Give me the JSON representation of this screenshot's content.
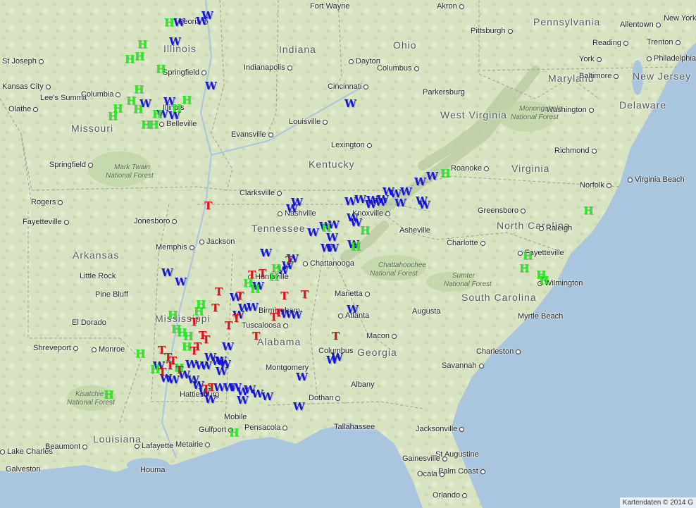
{
  "attribution": "Kartendaten © 2014 G",
  "colors": {
    "water": "#a9c6de",
    "land": "#d9e4c4",
    "forest": "#c4d7ab",
    "W": "#1414e0",
    "H": "#22ee22",
    "T": "#e01414"
  },
  "states": [
    "Illinois",
    "Indiana",
    "Ohio",
    "Pennsylvania",
    "Missouri",
    "Kentucky",
    "West Virginia",
    "Virginia",
    "Maryland",
    "New Jersey",
    "Delaware",
    "Tennessee",
    "North Carolina",
    "Arkansas",
    "South Carolina",
    "Mississippi",
    "Alabama",
    "Georgia",
    "Louisiana"
  ],
  "cities": [
    "Peoria",
    "Fort Wayne",
    "Akron",
    "New York",
    "Pittsburgh",
    "Allentown",
    "St Joseph",
    "Illinois",
    "Indianapolis",
    "Dayton",
    "Columbus",
    "Reading",
    "Trenton",
    "York",
    "Philadelphia",
    "Kansas City",
    "Lee's Summit",
    "Olathe",
    "Columbia",
    "Springfield",
    "Cincinnati",
    "Parkersburg",
    "Baltimore",
    "Belleville",
    "Louisville",
    "Evansville",
    "Washington",
    "Lexington",
    "Richmond",
    "Springfield",
    "Roanoke",
    "Norfolk",
    "Virginia Beach",
    "Clarksville",
    "Rogers",
    "Nashville",
    "Knoxville",
    "Greensboro",
    "Fayetteville",
    "Jonesboro",
    "Jackson",
    "Asheville",
    "Raleigh",
    "Memphis",
    "Charlotte",
    "Fayetteville",
    "Chattanooga",
    "Huntsville",
    "Little Rock",
    "Wilmington",
    "Pine Bluff",
    "Marietta",
    "Birmingham",
    "Atlanta",
    "Augusta",
    "Myrtle Beach",
    "El Dorado",
    "Tuscaloosa",
    "Macon",
    "Shreveport",
    "Monroe",
    "Columbus",
    "Charleston",
    "Montgomery",
    "Savannah",
    "Albany",
    "Dothan",
    "Hattiesburg",
    "Mobile",
    "Pensacola",
    "Tallahassee",
    "Jacksonville",
    "Lake Charles",
    "Beaumont",
    "Gulfport",
    "Lafayette",
    "Metairie",
    "St Augustine",
    "Gainesville",
    "Galveston",
    "Houma",
    "Palm Coast",
    "Ocala",
    "Orlando"
  ],
  "forests": [
    {
      "name": "Mark Twain",
      "sub": "National Forest"
    },
    {
      "name": "Monongahela",
      "sub": "National Forest"
    },
    {
      "name": "Chattahoochee",
      "sub": "National Forest"
    },
    {
      "name": "Sumter",
      "sub": "National Forest"
    },
    {
      "name": "Kisatchie",
      "sub": "National Forest"
    }
  ],
  "markers": {
    "W": {
      "label": "W"
    },
    "H": {
      "label": "H"
    },
    "T": {
      "label": "T"
    }
  }
}
